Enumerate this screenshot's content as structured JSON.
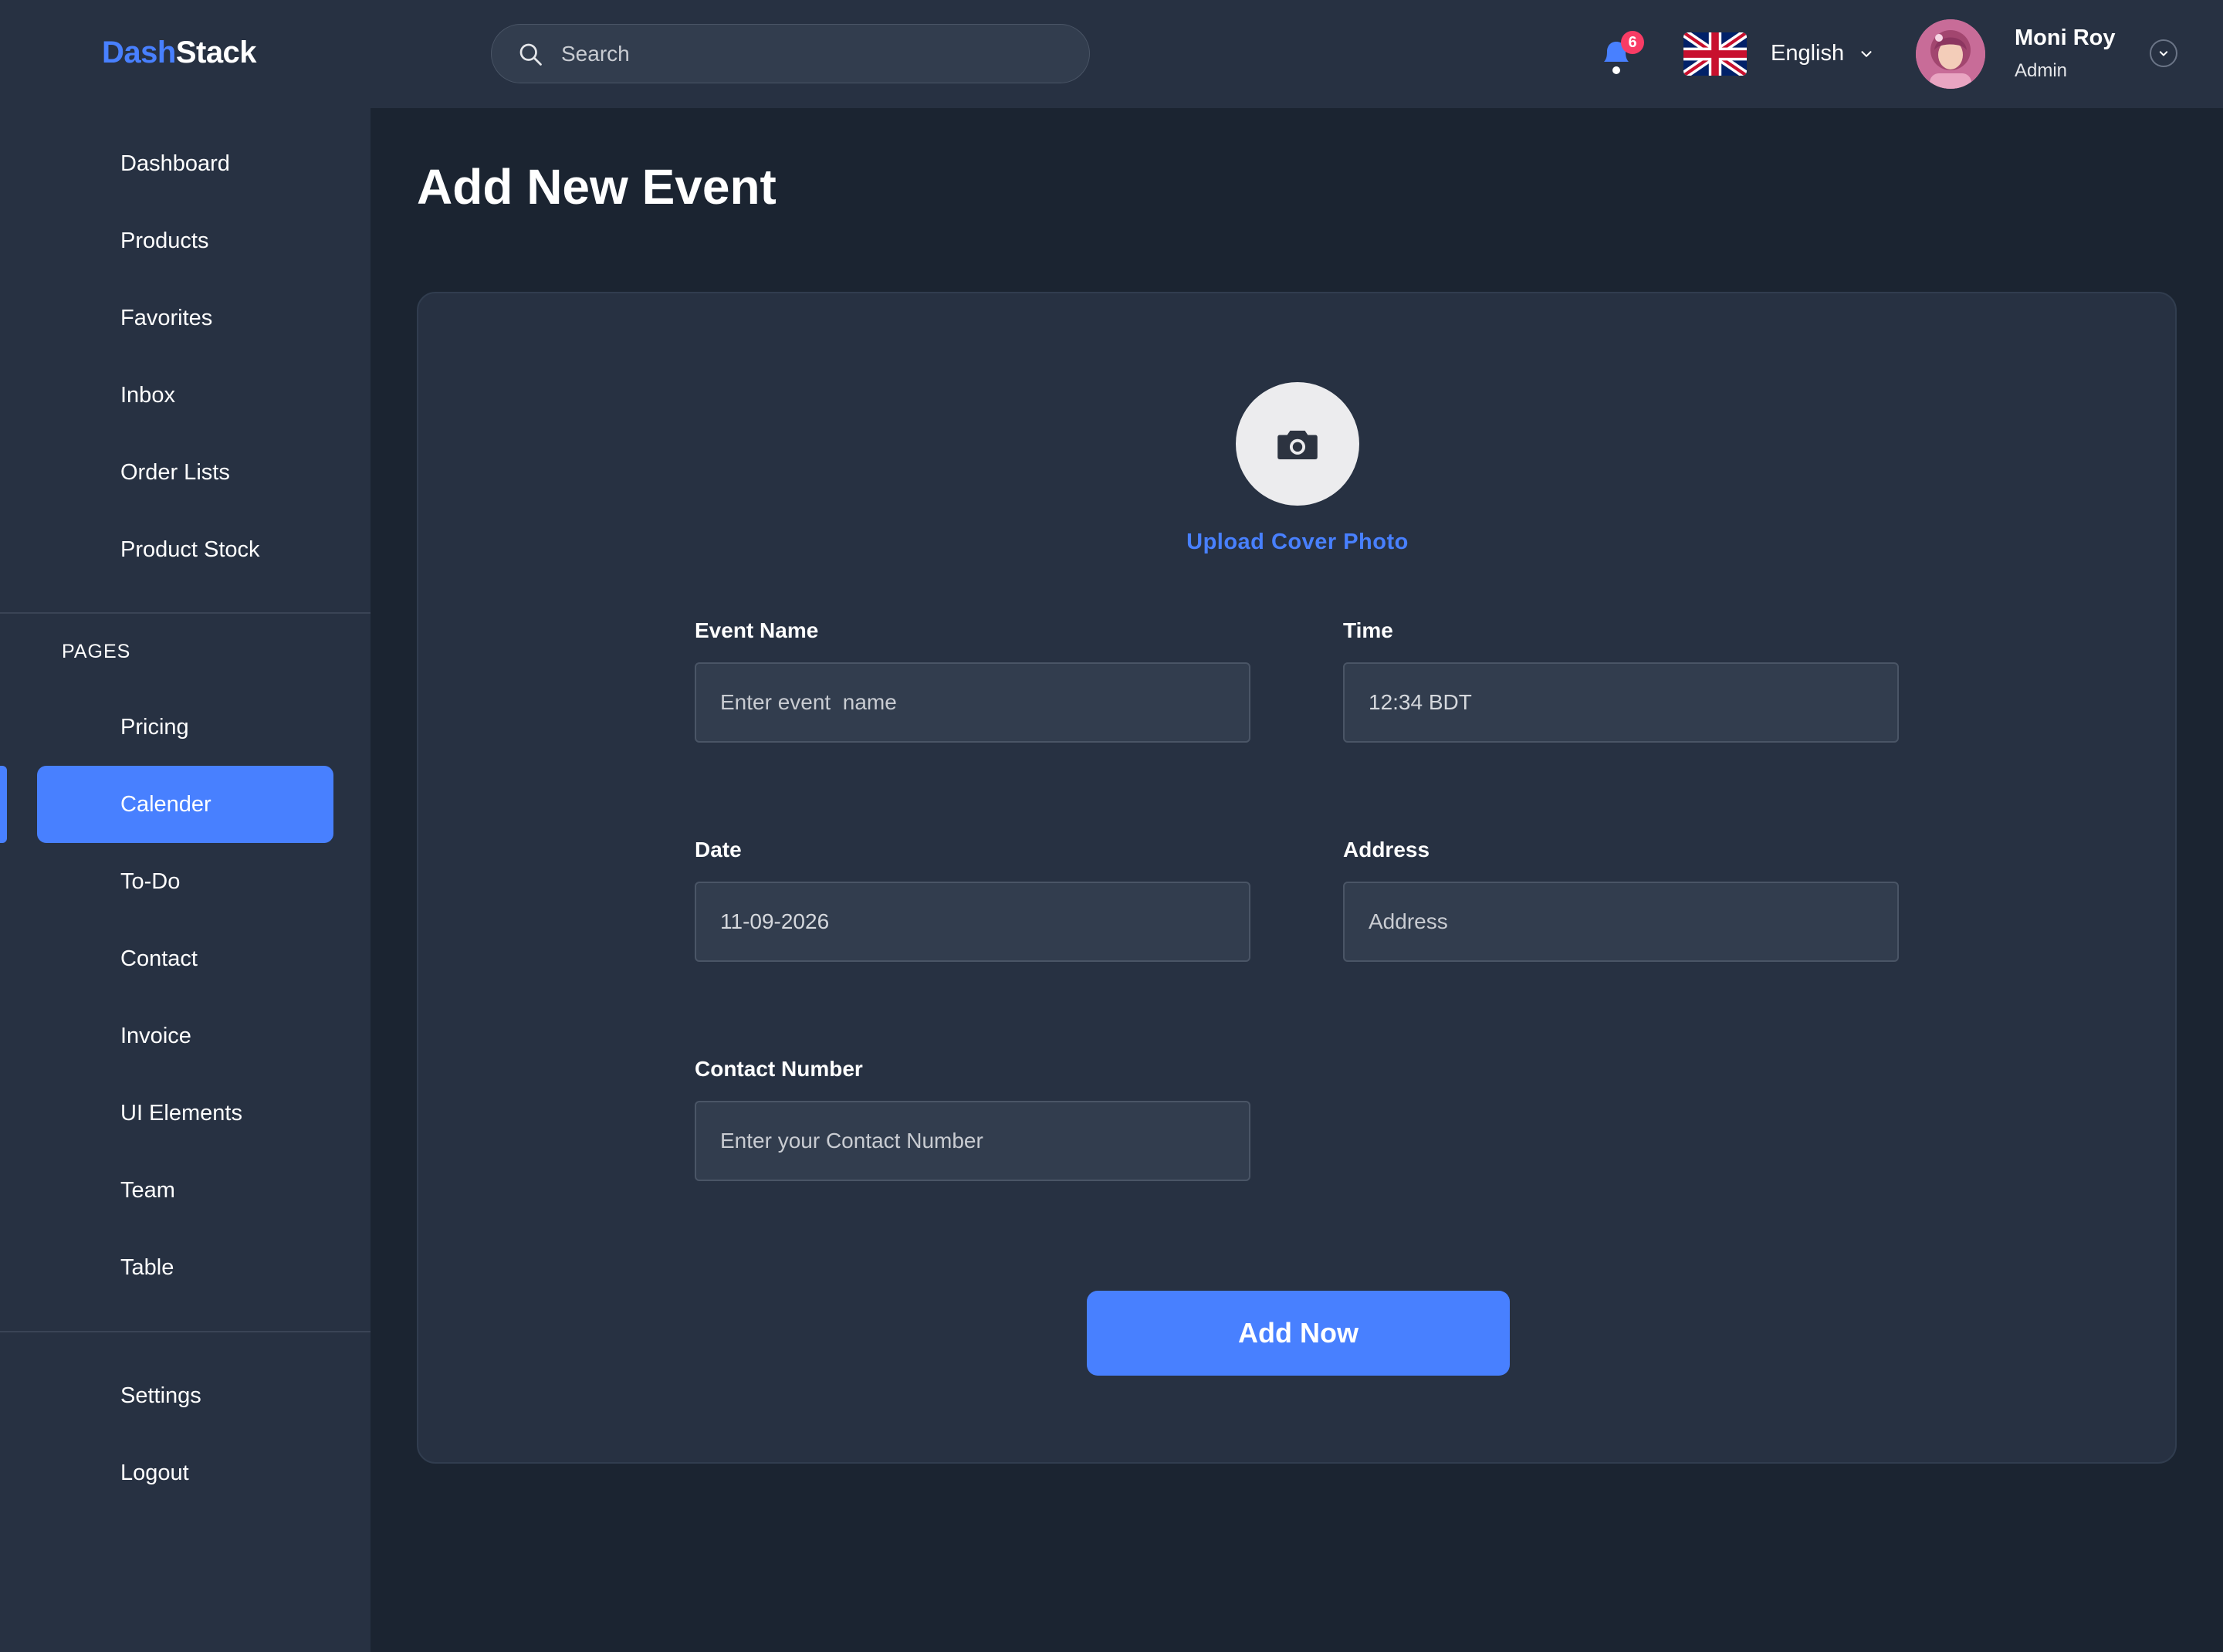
{
  "brand": {
    "part1": "Dash",
    "part2": "Stack"
  },
  "search": {
    "placeholder": "Search"
  },
  "notifications": {
    "count": "6"
  },
  "language": {
    "label": "English"
  },
  "user": {
    "name": "Moni Roy",
    "role": "Admin"
  },
  "sidebar": {
    "main_items": [
      {
        "label": "Dashboard"
      },
      {
        "label": "Products"
      },
      {
        "label": "Favorites"
      },
      {
        "label": "Inbox"
      },
      {
        "label": "Order Lists"
      },
      {
        "label": "Product Stock"
      }
    ],
    "pages_label": "PAGES",
    "page_items": [
      {
        "label": "Pricing"
      },
      {
        "label": "Calender",
        "active": true
      },
      {
        "label": "To-Do"
      },
      {
        "label": "Contact"
      },
      {
        "label": "Invoice"
      },
      {
        "label": "UI Elements"
      },
      {
        "label": "Team"
      },
      {
        "label": "Table"
      }
    ],
    "bottom_items": [
      {
        "label": "Settings"
      },
      {
        "label": "Logout"
      }
    ]
  },
  "page": {
    "title": "Add New Event"
  },
  "form": {
    "upload_label": "Upload Cover Photo",
    "event_name": {
      "label": "Event Name",
      "placeholder": "Enter event  name"
    },
    "time": {
      "label": "Time",
      "value": "12:34 BDT"
    },
    "date": {
      "label": "Date",
      "value": "11-09-2026"
    },
    "address": {
      "label": "Address",
      "placeholder": "Address"
    },
    "contact": {
      "label": "Contact Number",
      "placeholder": "Enter your Contact Number"
    },
    "submit_label": "Add Now"
  },
  "colors": {
    "accent": "#4880ff",
    "badge": "#f93c65",
    "background": "#1b2431",
    "panel": "#273142"
  }
}
